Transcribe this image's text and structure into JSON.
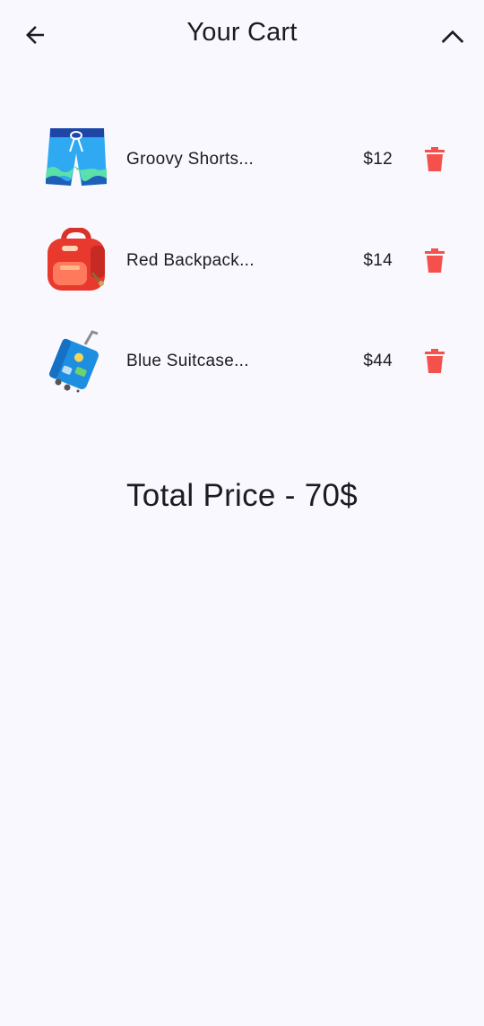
{
  "appbar": {
    "title": "Your Cart",
    "back_icon": "arrow-back-icon",
    "collapse_icon": "chevron-up-icon"
  },
  "cart": {
    "items": [
      {
        "name": "Groovy Shorts...",
        "price": "$12",
        "image_icon": "shorts-icon"
      },
      {
        "name": "Red Backpack...",
        "price": "$14",
        "image_icon": "backpack-icon"
      },
      {
        "name": "Blue Suitcase...",
        "price": "$44",
        "image_icon": "suitcase-icon"
      }
    ],
    "delete_icon": "trash-icon",
    "delete_color": "#f4514d"
  },
  "total": {
    "label": "Total Price - 70$"
  },
  "colors": {
    "background": "#f9f8fe",
    "text": "#1d1b20"
  }
}
